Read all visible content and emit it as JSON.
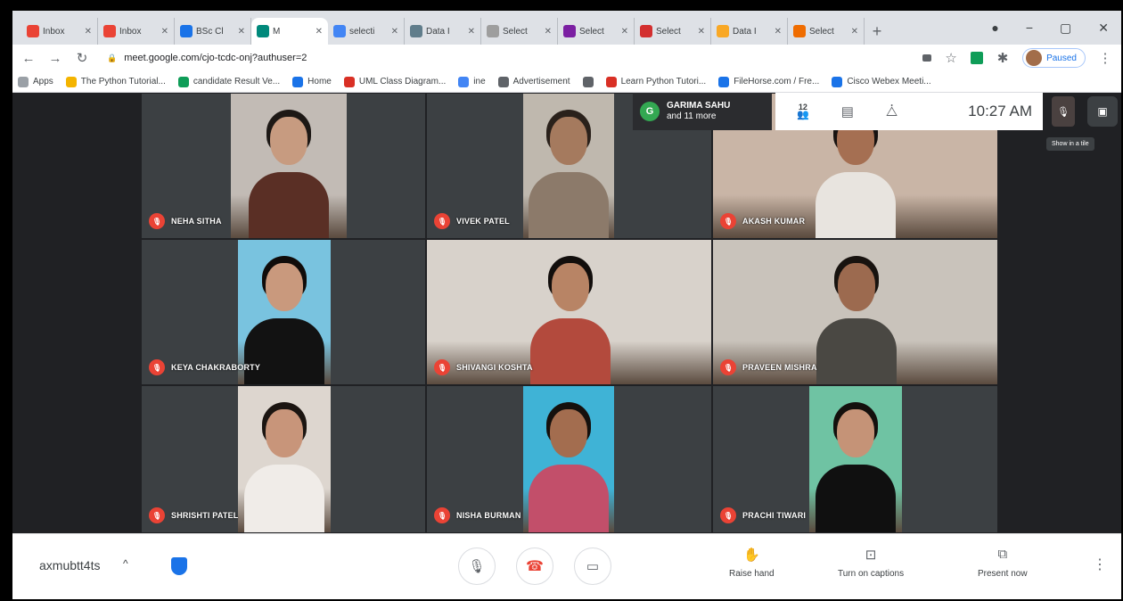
{
  "browser": {
    "tabs": [
      {
        "label": "Inbox",
        "favicon_color": "#ea4335"
      },
      {
        "label": "Inbox",
        "favicon_color": "#ea4335"
      },
      {
        "label": "BSc Cl",
        "favicon_color": "#1a73e8"
      },
      {
        "label": "M",
        "favicon_color": "#00897b",
        "active": true
      },
      {
        "label": "selecti",
        "favicon_color": "#4285f4"
      },
      {
        "label": "Data I",
        "favicon_color": "#607d8b"
      },
      {
        "label": "Select",
        "favicon_color": "#9e9e9e"
      },
      {
        "label": "Select",
        "favicon_color": "#7b1fa2"
      },
      {
        "label": "Select",
        "favicon_color": "#d32f2f"
      },
      {
        "label": "Data I",
        "favicon_color": "#f9a825"
      },
      {
        "label": "Select",
        "favicon_color": "#ef6c00"
      }
    ],
    "new_tab": "+",
    "window_controls": [
      "●",
      "−",
      "▢",
      "✕"
    ],
    "url": "meet.google.com/cjo-tcdc-onj?authuser=2",
    "paused_label": "Paused",
    "bookmarks": [
      {
        "label": "Apps",
        "color": "#9aa0a6"
      },
      {
        "label": "The Python Tutorial...",
        "color": "#f4b400"
      },
      {
        "label": "candidate Result Ve...",
        "color": "#0f9d58"
      },
      {
        "label": "Home",
        "color": "#1a73e8"
      },
      {
        "label": "UML Class Diagram...",
        "color": "#d93025"
      },
      {
        "label": "ine",
        "color": "#4285f4"
      },
      {
        "label": "Advertisement",
        "color": "#5f6368"
      },
      {
        "label": "",
        "color": "#5f6368"
      },
      {
        "label": "Learn Python Tutori...",
        "color": "#d93025"
      },
      {
        "label": "FileHorse.com / Fre...",
        "color": "#1a73e8"
      },
      {
        "label": "Cisco Webex Meeti...",
        "color": "#1a73e8"
      }
    ]
  },
  "meet": {
    "presence": {
      "initial": "G",
      "name": "GARIMA SAHU",
      "sub": "and 11 more"
    },
    "participant_count": "12",
    "clock": "10:27 AM",
    "tooltip": "Show in a tile",
    "participants": [
      {
        "name": "NEHA SITHA",
        "bg": "#c2bbb5",
        "shirt": "#5a2f25",
        "hair": "#1d1815",
        "skin": "#c79b80"
      },
      {
        "name": "VIVEK PATEL",
        "bg": "#bfb8ae",
        "shirt": "#8c7a6a",
        "hair": "#2a211b",
        "skin": "#a57a5e"
      },
      {
        "name": "AKASH KUMAR",
        "bg": "#c9b5a6",
        "shirt": "#e8e4df",
        "hair": "#171210",
        "skin": "#a56f52"
      },
      {
        "name": "KEYA CHAKRABORTY",
        "bg": "#79c3df",
        "shirt": "#121212",
        "hair": "#100c0a",
        "skin": "#c9997d"
      },
      {
        "name": "SHIVANGI KOSHTA",
        "bg": "#d8d2cb",
        "shirt": "#b34a3d",
        "hair": "#120e0c",
        "skin": "#b88465"
      },
      {
        "name": "PRAVEEN MISHRA",
        "bg": "#c9c3bb",
        "shirt": "#4a4843",
        "hair": "#18130f",
        "skin": "#9c6a4f"
      },
      {
        "name": "SHRISHTI PATEL",
        "bg": "#ddd6cf",
        "shirt": "#f0ece8",
        "hair": "#1b1511",
        "skin": "#c8957a"
      },
      {
        "name": "NISHA BURMAN",
        "bg": "#3fb3d6",
        "shirt": "#c24f6a",
        "hair": "#15100d",
        "skin": "#a36d4f"
      },
      {
        "name": "PRACHI TIWARI",
        "bg": "#6fc3a3",
        "shirt": "#101010",
        "hair": "#14100d",
        "skin": "#c59377"
      }
    ],
    "meeting_code": "axmubtt4ts",
    "chevron": "^",
    "actions": {
      "raise_hand": "Raise hand",
      "captions": "Turn on captions",
      "present": "Present now"
    }
  }
}
